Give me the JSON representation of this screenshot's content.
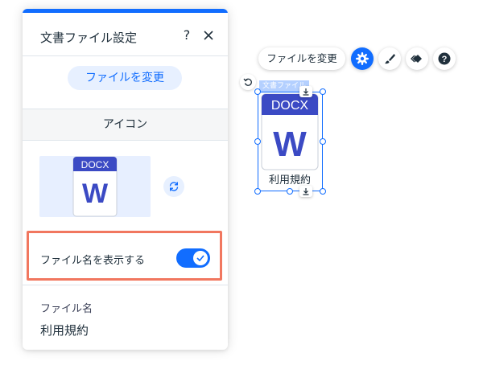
{
  "panel": {
    "title": "文書ファイル設定",
    "help_label": "?",
    "change_button_label": "ファイルを変更",
    "section_icon_label": "アイコン",
    "toggle_label": "ファイル名を表示する",
    "toggle_on": true,
    "filename_field_label": "ファイル名",
    "filename_value": "利用規約"
  },
  "doc_icon": {
    "type_label": "DOCX",
    "letter": "W",
    "brand_color": "#3b4ac4"
  },
  "toolbar": {
    "change_file_label": "ファイルを変更",
    "buttons": [
      "gear-icon",
      "brush-icon",
      "animation-icon",
      "help-icon"
    ]
  },
  "canvas": {
    "element_tag": "文書ファイル",
    "filename": "利用規約"
  },
  "colors": {
    "accent": "#116dff",
    "highlight": "#f1775f",
    "accent_light": "#e7f0ff"
  }
}
